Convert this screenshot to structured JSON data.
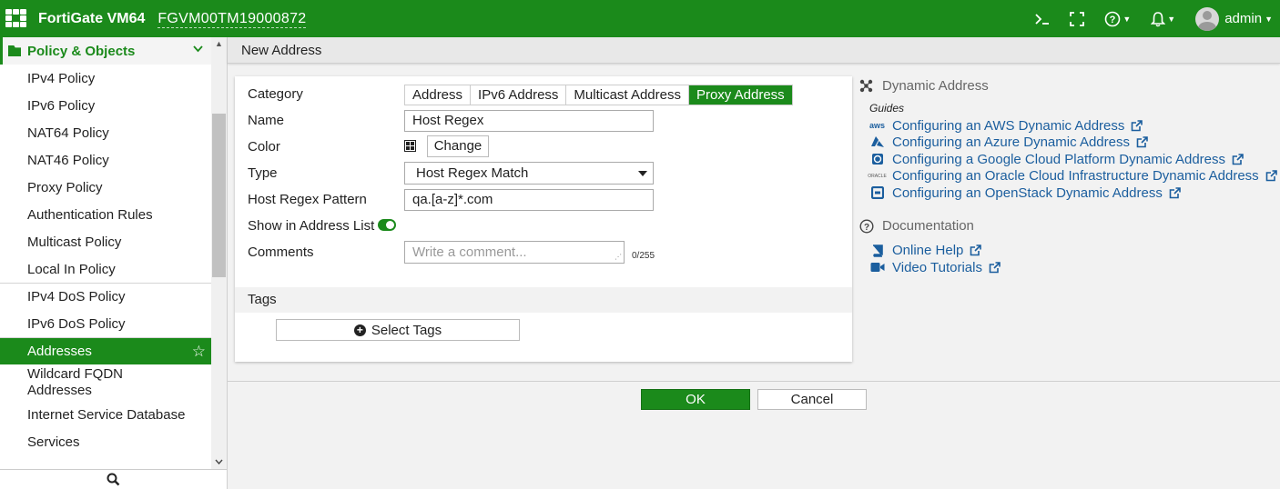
{
  "header": {
    "app_title": "FortiGate VM64",
    "serial": "FGVM00TM19000872",
    "user": "admin",
    "icons": [
      "cli-console-icon",
      "fullscreen-icon",
      "help-icon",
      "notification-bell-icon",
      "user-avatar-icon"
    ]
  },
  "sidebar": {
    "section": "Policy & Objects",
    "items": [
      {
        "label": "IPv4 Policy"
      },
      {
        "label": "IPv6 Policy"
      },
      {
        "label": "NAT64 Policy"
      },
      {
        "label": "NAT46 Policy"
      },
      {
        "label": "Proxy Policy"
      },
      {
        "label": "Authentication Rules"
      },
      {
        "label": "Multicast Policy"
      },
      {
        "label": "Local In Policy"
      },
      {
        "label": "IPv4 DoS Policy"
      },
      {
        "label": "IPv6 DoS Policy"
      },
      {
        "label": "Addresses",
        "active": true
      },
      {
        "label": "Wildcard FQDN Addresses"
      },
      {
        "label": "Internet Service Database"
      },
      {
        "label": "Services"
      }
    ]
  },
  "page": {
    "title": "New Address"
  },
  "form": {
    "category_label": "Category",
    "category_options": [
      "Address",
      "IPv6 Address",
      "Multicast Address",
      "Proxy Address"
    ],
    "category_selected": "Proxy Address",
    "name_label": "Name",
    "name_value": "Host Regex",
    "color_label": "Color",
    "color_change_label": "Change",
    "type_label": "Type",
    "type_value": "Host Regex Match",
    "host_regex_label": "Host Regex Pattern",
    "host_regex_value": "qa.[a-z]*.com",
    "show_in_list_label": "Show in Address List",
    "show_in_list_enabled": true,
    "comments_label": "Comments",
    "comments_placeholder": "Write a comment...",
    "comments_counter": "0/255",
    "tags_label": "Tags",
    "select_tags_label": "Select Tags"
  },
  "right_panel": {
    "dynamic_title": "Dynamic Address",
    "guides_label": "Guides",
    "guides": [
      {
        "label": "Configuring an AWS Dynamic Address",
        "icon": "aws-icon"
      },
      {
        "label": "Configuring an Azure Dynamic Address",
        "icon": "azure-icon"
      },
      {
        "label": "Configuring a Google Cloud Platform Dynamic Address",
        "icon": "gcp-icon"
      },
      {
        "label": "Configuring an Oracle Cloud Infrastructure Dynamic Address",
        "icon": "oracle-icon"
      },
      {
        "label": "Configuring an OpenStack Dynamic Address",
        "icon": "openstack-icon"
      }
    ],
    "doc_title": "Documentation",
    "docs": [
      {
        "label": "Online Help",
        "icon": "book-icon"
      },
      {
        "label": "Video Tutorials",
        "icon": "video-icon"
      }
    ]
  },
  "footer": {
    "ok_label": "OK",
    "cancel_label": "Cancel"
  },
  "colors": {
    "brand_green": "#1b8a1b",
    "link_blue": "#1b5e9e"
  }
}
